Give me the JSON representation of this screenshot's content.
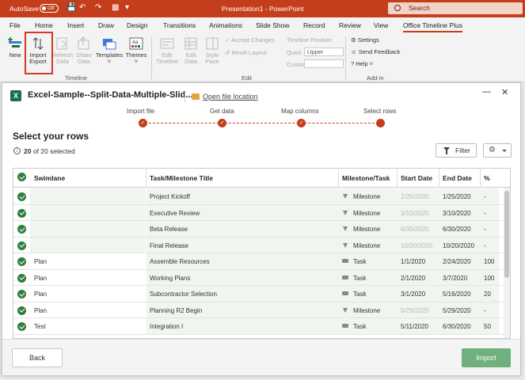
{
  "titlebar": {
    "autosave_label": "AutoSave",
    "autosave_state": "Off",
    "doc_title": "Presentation1 - PowerPoint",
    "search_placeholder": "Search",
    "accent": "#c43e1c"
  },
  "tabs": [
    "File",
    "Home",
    "Insert",
    "Draw",
    "Design",
    "Transitions",
    "Animations",
    "Slide Show",
    "Record",
    "Review",
    "View",
    "Office Timeline Plus"
  ],
  "active_tab": "Office Timeline Plus",
  "ribbon": {
    "timeline_group": {
      "label": "Timeline",
      "new": "New",
      "import_l1": "Import",
      "import_l2": "Export",
      "refresh_l1": "Refresh",
      "refresh_l2": "Data",
      "share_l1": "Share",
      "share_l2": "Data",
      "templates": "Templates",
      "themes": "Themes"
    },
    "edit_group": {
      "label": "Edit",
      "edit_timeline_l1": "Edit",
      "edit_timeline_l2": "Timeline",
      "edit_data_l1": "Edit",
      "edit_data_l2": "Data",
      "style_pane_l1": "Style",
      "style_pane_l2": "Pane",
      "accept_changes": "Accept Changes",
      "reset_layout": "Reset Layout",
      "timeline_position": "Timeline Position",
      "quick": "Quick",
      "quick_value": "Upper",
      "custom": "Custom"
    },
    "addin_group": {
      "label": "Add-in",
      "settings": "Settings",
      "send_feedback": "Send Feedback",
      "help": "Help"
    }
  },
  "dialog": {
    "file_name": "Excel-Sample--Split-Data-Multiple-Slid...",
    "open_file_location": "Open file location",
    "steps": [
      "Import file",
      "Get data",
      "Map columns",
      "Select rows"
    ],
    "heading": "Select your rows",
    "selected_count": "20",
    "selected_suffix": "of 20 selected",
    "filter_label": "Filter",
    "columns": [
      "Swimlane",
      "Task/Milestone Title",
      "Milestone/Task",
      "Start Date",
      "End Date",
      "%"
    ],
    "rows": [
      {
        "swimlane": "",
        "title": "Project Kickoff",
        "type": "Milestone",
        "start": "1/25/2020",
        "end": "1/25/2020",
        "pct": "-",
        "start_muted": true
      },
      {
        "swimlane": "",
        "title": "Executive Review",
        "type": "Milestone",
        "start": "3/10/2020",
        "end": "3/10/2020",
        "pct": "-",
        "start_muted": true
      },
      {
        "swimlane": "",
        "title": "Beta Release",
        "type": "Milestone",
        "start": "6/30/2020",
        "end": "6/30/2020",
        "pct": "-",
        "start_muted": true
      },
      {
        "swimlane": "",
        "title": "Final Release",
        "type": "Milestone",
        "start": "10/20/2020",
        "end": "10/20/2020",
        "pct": "-",
        "start_muted": true
      },
      {
        "swimlane": "Plan",
        "title": "Assemble Resources",
        "type": "Task",
        "start": "1/1/2020",
        "end": "2/24/2020",
        "pct": "100",
        "start_muted": false
      },
      {
        "swimlane": "Plan",
        "title": "Working Plans",
        "type": "Task",
        "start": "2/1/2020",
        "end": "3/7/2020",
        "pct": "100",
        "start_muted": false
      },
      {
        "swimlane": "Plan",
        "title": "Subcontractor Selection",
        "type": "Task",
        "start": "3/1/2020",
        "end": "5/16/2020",
        "pct": "20",
        "start_muted": false
      },
      {
        "swimlane": "Plan",
        "title": "Planning R2 Begin",
        "type": "Milestone",
        "start": "5/29/2020",
        "end": "5/29/2020",
        "pct": "-",
        "start_muted": true
      },
      {
        "swimlane": "Test",
        "title": "Integration I",
        "type": "Task",
        "start": "5/11/2020",
        "end": "6/30/2020",
        "pct": "50",
        "start_muted": false
      }
    ],
    "back_label": "Back",
    "import_label": "Import",
    "check_color": "#2f7d3f",
    "import_color": "#6fb07e"
  }
}
